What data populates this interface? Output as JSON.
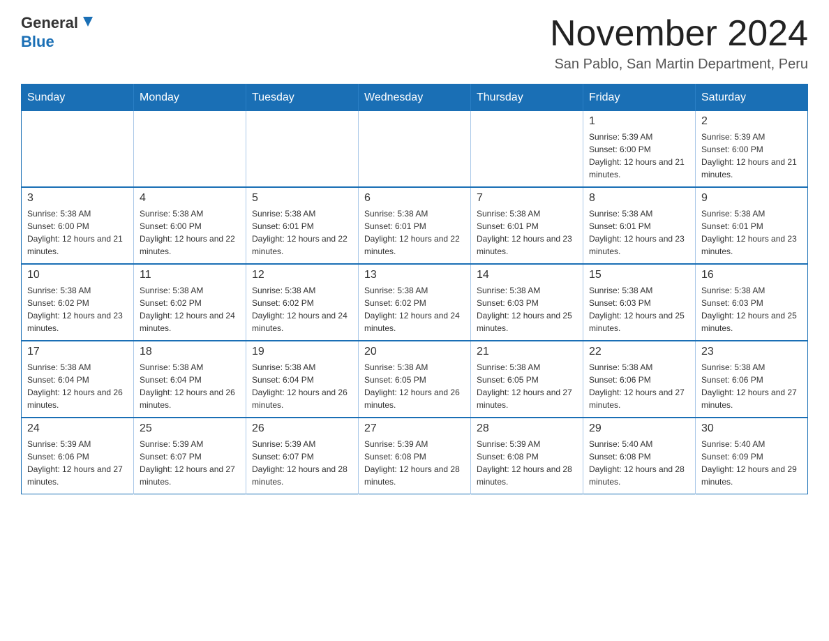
{
  "header": {
    "logo_line1": "General",
    "logo_line2": "Blue",
    "month_title": "November 2024",
    "location": "San Pablo, San Martin Department, Peru"
  },
  "weekdays": [
    "Sunday",
    "Monday",
    "Tuesday",
    "Wednesday",
    "Thursday",
    "Friday",
    "Saturday"
  ],
  "weeks": [
    [
      {
        "day": "",
        "sunrise": "",
        "sunset": "",
        "daylight": ""
      },
      {
        "day": "",
        "sunrise": "",
        "sunset": "",
        "daylight": ""
      },
      {
        "day": "",
        "sunrise": "",
        "sunset": "",
        "daylight": ""
      },
      {
        "day": "",
        "sunrise": "",
        "sunset": "",
        "daylight": ""
      },
      {
        "day": "",
        "sunrise": "",
        "sunset": "",
        "daylight": ""
      },
      {
        "day": "1",
        "sunrise": "Sunrise: 5:39 AM",
        "sunset": "Sunset: 6:00 PM",
        "daylight": "Daylight: 12 hours and 21 minutes."
      },
      {
        "day": "2",
        "sunrise": "Sunrise: 5:39 AM",
        "sunset": "Sunset: 6:00 PM",
        "daylight": "Daylight: 12 hours and 21 minutes."
      }
    ],
    [
      {
        "day": "3",
        "sunrise": "Sunrise: 5:38 AM",
        "sunset": "Sunset: 6:00 PM",
        "daylight": "Daylight: 12 hours and 21 minutes."
      },
      {
        "day": "4",
        "sunrise": "Sunrise: 5:38 AM",
        "sunset": "Sunset: 6:00 PM",
        "daylight": "Daylight: 12 hours and 22 minutes."
      },
      {
        "day": "5",
        "sunrise": "Sunrise: 5:38 AM",
        "sunset": "Sunset: 6:01 PM",
        "daylight": "Daylight: 12 hours and 22 minutes."
      },
      {
        "day": "6",
        "sunrise": "Sunrise: 5:38 AM",
        "sunset": "Sunset: 6:01 PM",
        "daylight": "Daylight: 12 hours and 22 minutes."
      },
      {
        "day": "7",
        "sunrise": "Sunrise: 5:38 AM",
        "sunset": "Sunset: 6:01 PM",
        "daylight": "Daylight: 12 hours and 23 minutes."
      },
      {
        "day": "8",
        "sunrise": "Sunrise: 5:38 AM",
        "sunset": "Sunset: 6:01 PM",
        "daylight": "Daylight: 12 hours and 23 minutes."
      },
      {
        "day": "9",
        "sunrise": "Sunrise: 5:38 AM",
        "sunset": "Sunset: 6:01 PM",
        "daylight": "Daylight: 12 hours and 23 minutes."
      }
    ],
    [
      {
        "day": "10",
        "sunrise": "Sunrise: 5:38 AM",
        "sunset": "Sunset: 6:02 PM",
        "daylight": "Daylight: 12 hours and 23 minutes."
      },
      {
        "day": "11",
        "sunrise": "Sunrise: 5:38 AM",
        "sunset": "Sunset: 6:02 PM",
        "daylight": "Daylight: 12 hours and 24 minutes."
      },
      {
        "day": "12",
        "sunrise": "Sunrise: 5:38 AM",
        "sunset": "Sunset: 6:02 PM",
        "daylight": "Daylight: 12 hours and 24 minutes."
      },
      {
        "day": "13",
        "sunrise": "Sunrise: 5:38 AM",
        "sunset": "Sunset: 6:02 PM",
        "daylight": "Daylight: 12 hours and 24 minutes."
      },
      {
        "day": "14",
        "sunrise": "Sunrise: 5:38 AM",
        "sunset": "Sunset: 6:03 PM",
        "daylight": "Daylight: 12 hours and 25 minutes."
      },
      {
        "day": "15",
        "sunrise": "Sunrise: 5:38 AM",
        "sunset": "Sunset: 6:03 PM",
        "daylight": "Daylight: 12 hours and 25 minutes."
      },
      {
        "day": "16",
        "sunrise": "Sunrise: 5:38 AM",
        "sunset": "Sunset: 6:03 PM",
        "daylight": "Daylight: 12 hours and 25 minutes."
      }
    ],
    [
      {
        "day": "17",
        "sunrise": "Sunrise: 5:38 AM",
        "sunset": "Sunset: 6:04 PM",
        "daylight": "Daylight: 12 hours and 26 minutes."
      },
      {
        "day": "18",
        "sunrise": "Sunrise: 5:38 AM",
        "sunset": "Sunset: 6:04 PM",
        "daylight": "Daylight: 12 hours and 26 minutes."
      },
      {
        "day": "19",
        "sunrise": "Sunrise: 5:38 AM",
        "sunset": "Sunset: 6:04 PM",
        "daylight": "Daylight: 12 hours and 26 minutes."
      },
      {
        "day": "20",
        "sunrise": "Sunrise: 5:38 AM",
        "sunset": "Sunset: 6:05 PM",
        "daylight": "Daylight: 12 hours and 26 minutes."
      },
      {
        "day": "21",
        "sunrise": "Sunrise: 5:38 AM",
        "sunset": "Sunset: 6:05 PM",
        "daylight": "Daylight: 12 hours and 27 minutes."
      },
      {
        "day": "22",
        "sunrise": "Sunrise: 5:38 AM",
        "sunset": "Sunset: 6:06 PM",
        "daylight": "Daylight: 12 hours and 27 minutes."
      },
      {
        "day": "23",
        "sunrise": "Sunrise: 5:38 AM",
        "sunset": "Sunset: 6:06 PM",
        "daylight": "Daylight: 12 hours and 27 minutes."
      }
    ],
    [
      {
        "day": "24",
        "sunrise": "Sunrise: 5:39 AM",
        "sunset": "Sunset: 6:06 PM",
        "daylight": "Daylight: 12 hours and 27 minutes."
      },
      {
        "day": "25",
        "sunrise": "Sunrise: 5:39 AM",
        "sunset": "Sunset: 6:07 PM",
        "daylight": "Daylight: 12 hours and 27 minutes."
      },
      {
        "day": "26",
        "sunrise": "Sunrise: 5:39 AM",
        "sunset": "Sunset: 6:07 PM",
        "daylight": "Daylight: 12 hours and 28 minutes."
      },
      {
        "day": "27",
        "sunrise": "Sunrise: 5:39 AM",
        "sunset": "Sunset: 6:08 PM",
        "daylight": "Daylight: 12 hours and 28 minutes."
      },
      {
        "day": "28",
        "sunrise": "Sunrise: 5:39 AM",
        "sunset": "Sunset: 6:08 PM",
        "daylight": "Daylight: 12 hours and 28 minutes."
      },
      {
        "day": "29",
        "sunrise": "Sunrise: 5:40 AM",
        "sunset": "Sunset: 6:08 PM",
        "daylight": "Daylight: 12 hours and 28 minutes."
      },
      {
        "day": "30",
        "sunrise": "Sunrise: 5:40 AM",
        "sunset": "Sunset: 6:09 PM",
        "daylight": "Daylight: 12 hours and 29 minutes."
      }
    ]
  ]
}
